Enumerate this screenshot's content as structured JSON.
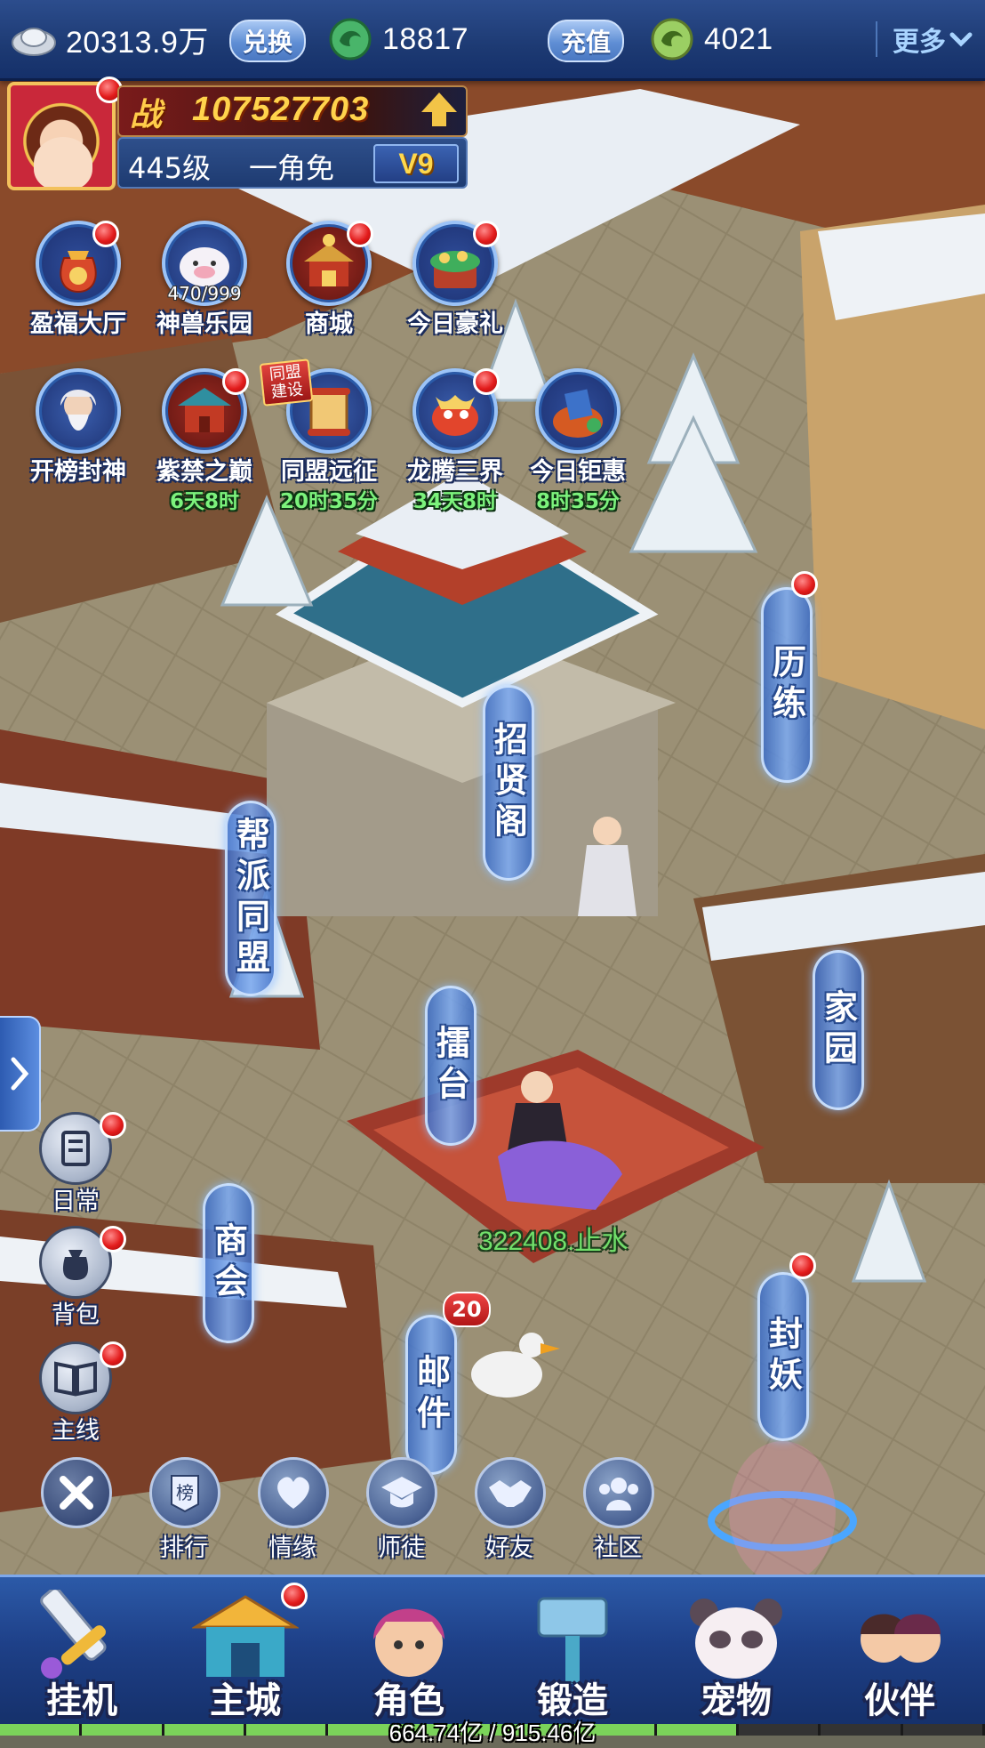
{
  "currency": [
    {
      "icon": "silver-ingot-icon",
      "value": "20313.9万",
      "button": "兑换"
    },
    {
      "icon": "jade-coin-icon",
      "value": "18817",
      "button": "充值"
    },
    {
      "icon": "bound-jade-icon",
      "value": "4021"
    }
  ],
  "more_label": "更多",
  "player": {
    "power_label": "战",
    "power": "107527703",
    "level": "445级",
    "name": "一角免",
    "vip": "V9"
  },
  "activities_row1": [
    {
      "label": "盈福大厅",
      "icon": "fortune-bag-icon"
    },
    {
      "label": "神兽乐园",
      "icon": "divine-beast-icon",
      "count": "470/999"
    },
    {
      "label": "商城",
      "icon": "shop-pavilion-icon"
    },
    {
      "label": "今日豪礼",
      "icon": "treasure-pot-icon"
    }
  ],
  "activities_row2": [
    {
      "label": "开榜封神",
      "icon": "immortal-sage-icon"
    },
    {
      "label": "紫禁之巅",
      "icon": "forbidden-palace-icon",
      "timer": "6天8时"
    },
    {
      "label": "同盟远征",
      "icon": "scroll-icon",
      "timer": "20时35分",
      "tag": "同盟\n建设"
    },
    {
      "label": "龙腾三界",
      "icon": "dragon-icon",
      "timer": "34天8时"
    },
    {
      "label": "今日钜惠",
      "icon": "gift-sack-icon",
      "timer": "8时35分"
    }
  ],
  "buildings": {
    "liandian": "历练",
    "zhaoxian": "招贤阁",
    "bangpai": "帮派同盟",
    "leitai": "擂台",
    "jiayuan": "家园",
    "shanghui": "商会",
    "youjian": "邮件",
    "fengyao": "封妖"
  },
  "mail_count": "20",
  "player_tag": "322408.止水",
  "side_buttons": [
    {
      "label": "日常",
      "icon": "daily-scroll-icon"
    },
    {
      "label": "背包",
      "icon": "backpack-icon"
    },
    {
      "label": "主线",
      "icon": "book-icon"
    }
  ],
  "social": [
    {
      "label": "",
      "icon": "close-icon"
    },
    {
      "label": "排行",
      "icon": "ranking-icon",
      "glyph": "榜"
    },
    {
      "label": "情缘",
      "icon": "heart-icon"
    },
    {
      "label": "师徒",
      "icon": "graduation-cap-icon"
    },
    {
      "label": "好友",
      "icon": "handshake-icon"
    },
    {
      "label": "社区",
      "icon": "community-icon"
    }
  ],
  "nav": [
    {
      "label": "挂机",
      "icon": "sword-icon"
    },
    {
      "label": "主城",
      "icon": "city-gate-icon"
    },
    {
      "label": "角色",
      "icon": "character-icon"
    },
    {
      "label": "锻造",
      "icon": "forge-hammer-icon"
    },
    {
      "label": "宠物",
      "icon": "panda-pet-icon"
    },
    {
      "label": "伙伴",
      "icon": "companions-icon"
    }
  ],
  "exp_text": "664.74亿 / 915.46亿",
  "exp_fraction": 0.726
}
